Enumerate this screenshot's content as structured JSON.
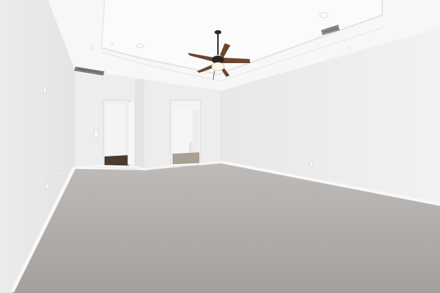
{
  "scene": {
    "subject": "empty-bedroom-interior",
    "elements": [
      "tray-ceiling",
      "ceiling-fan",
      "recessed-lights",
      "air-vents",
      "doorway-closet",
      "doorway-bathroom",
      "carpet-floor",
      "baseboards",
      "wall-outlets",
      "light-switch"
    ]
  },
  "colors": {
    "wall": "#eeeeee",
    "wall_shadow": "#e2e2e2",
    "ceiling": "#f6f6f6",
    "carpet": "#a9a4a1",
    "baseboard": "#f8f8f8",
    "fan_blade": "#6b4630",
    "fan_motor": "#2a2522",
    "floor_doorway": "#4a3b31"
  }
}
